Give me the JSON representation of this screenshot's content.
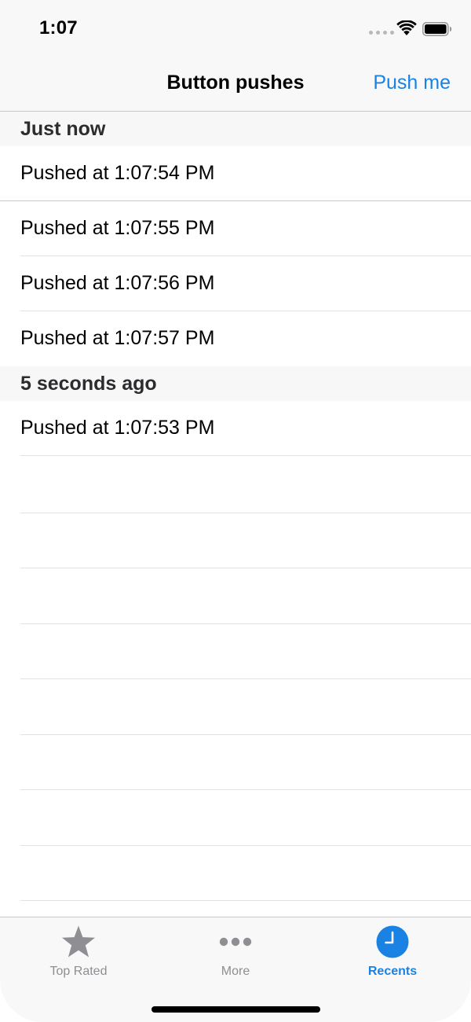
{
  "status_bar": {
    "time": "1:07"
  },
  "nav": {
    "title": "Button pushes",
    "action_label": "Push me"
  },
  "sections": [
    {
      "header": "Just now",
      "rows": [
        "Pushed at 1:07:54 PM",
        "Pushed at 1:07:55 PM",
        "Pushed at 1:07:56 PM",
        "Pushed at 1:07:57 PM"
      ]
    },
    {
      "header": "5 seconds ago",
      "rows": [
        "Pushed at 1:07:53 PM"
      ]
    }
  ],
  "tabs": [
    {
      "label": "Top Rated",
      "icon": "star-icon",
      "active": false
    },
    {
      "label": "More",
      "icon": "more-icon",
      "active": false
    },
    {
      "label": "Recents",
      "icon": "clock-icon",
      "active": true
    }
  ],
  "colors": {
    "accent": "#1a82e2",
    "inactive": "#8e8e93",
    "bar_background": "#f8f8f8",
    "separator": "#e2e2e4"
  }
}
